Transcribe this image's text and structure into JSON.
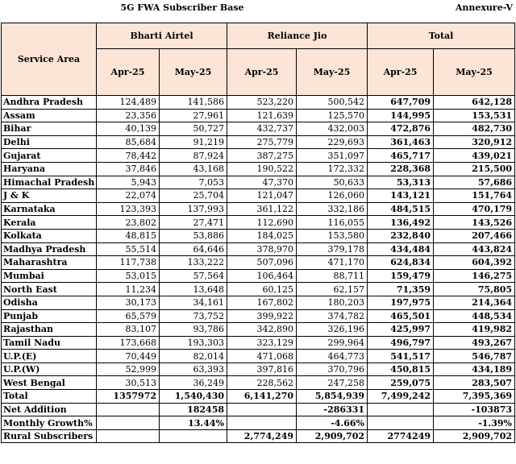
{
  "header": {
    "title": "5G FWA Subscriber Base",
    "annexure": "Annexure-V"
  },
  "table": {
    "service_area_label": "Service Area",
    "operators": [
      "Bharti Airtel",
      "Reliance Jio",
      "Total"
    ],
    "months": [
      "Apr-25",
      "May-25",
      "Apr-25",
      "May-25",
      "Apr-25",
      "May-25"
    ],
    "rows": [
      [
        "Andhra Pradesh",
        "124,489",
        "141,586",
        "523,220",
        "500,542",
        "647,709",
        "642,128"
      ],
      [
        "Assam",
        "23,356",
        "27,961",
        "121,639",
        "125,570",
        "144,995",
        "153,531"
      ],
      [
        "Bihar",
        "40,139",
        "50,727",
        "432,737",
        "432,003",
        "472,876",
        "482,730"
      ],
      [
        "Delhi",
        "85,684",
        "91,219",
        "275,779",
        "229,693",
        "361,463",
        "320,912"
      ],
      [
        "Gujarat",
        "78,442",
        "87,924",
        "387,275",
        "351,097",
        "465,717",
        "439,021"
      ],
      [
        "Haryana",
        "37,846",
        "43,168",
        "190,522",
        "172,332",
        "228,368",
        "215,500"
      ],
      [
        "Himachal Pradesh",
        "5,943",
        "7,053",
        "47,370",
        "50,633",
        "53,313",
        "57,686"
      ],
      [
        "J & K",
        "22,074",
        "25,704",
        "121,047",
        "126,060",
        "143,121",
        "151,764"
      ],
      [
        "Karnataka",
        "123,393",
        "137,993",
        "361,122",
        "332,186",
        "484,515",
        "470,179"
      ],
      [
        "Kerala",
        "23,802",
        "27,471",
        "112,690",
        "116,055",
        "136,492",
        "143,526"
      ],
      [
        "Kolkata",
        "48,815",
        "53,886",
        "184,025",
        "153,580",
        "232,840",
        "207,466"
      ],
      [
        "Madhya Pradesh",
        "55,514",
        "64,646",
        "378,970",
        "379,178",
        "434,484",
        "443,824"
      ],
      [
        "Maharashtra",
        "117,738",
        "133,222",
        "507,096",
        "471,170",
        "624,834",
        "604,392"
      ],
      [
        "Mumbai",
        "53,015",
        "57,564",
        "106,464",
        "88,711",
        "159,479",
        "146,275"
      ],
      [
        "North East",
        "11,234",
        "13,648",
        "60,125",
        "62,157",
        "71,359",
        "75,805"
      ],
      [
        "Odisha",
        "30,173",
        "34,161",
        "167,802",
        "180,203",
        "197,975",
        "214,364"
      ],
      [
        "Punjab",
        "65,579",
        "73,752",
        "399,922",
        "374,782",
        "465,501",
        "448,534"
      ],
      [
        "Rajasthan",
        "83,107",
        "93,786",
        "342,890",
        "326,196",
        "425,997",
        "419,982"
      ],
      [
        "Tamil Nadu",
        "173,668",
        "193,303",
        "323,129",
        "299,964",
        "496,797",
        "493,267"
      ],
      [
        "U.P.(E)",
        "70,449",
        "82,014",
        "471,068",
        "464,773",
        "541,517",
        "546,787"
      ],
      [
        "U.P.(W)",
        "52,999",
        "63,393",
        "397,816",
        "370,796",
        "450,815",
        "434,189"
      ],
      [
        "West Bengal",
        "30,513",
        "36,249",
        "228,562",
        "247,258",
        "259,075",
        "283,507"
      ]
    ],
    "summary_rows": [
      [
        "Total",
        "1357972",
        "1,540,430",
        "6,141,270",
        "5,854,939",
        "7,499,242",
        "7,395,369"
      ],
      [
        "Net Addition",
        "",
        "182458",
        "",
        "-286331",
        "",
        "-103873"
      ],
      [
        "Monthly Growth%",
        "",
        "13.44%",
        "",
        "-4.66%",
        "",
        "-1.39%"
      ],
      [
        "Rural Subscribers",
        "",
        "",
        "2,774,249",
        "2,909,702",
        "2774249",
        "2,909,702"
      ]
    ]
  }
}
